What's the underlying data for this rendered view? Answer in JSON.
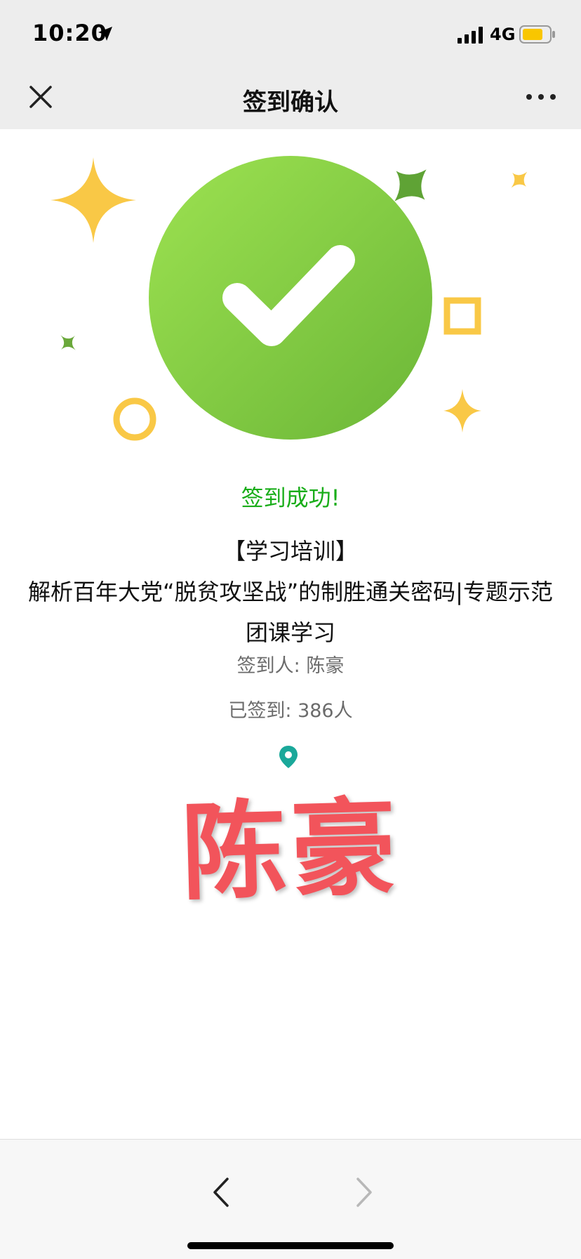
{
  "status_bar": {
    "time": "10:20",
    "network": "4G"
  },
  "nav": {
    "title": "签到确认"
  },
  "content": {
    "success_message": "签到成功!",
    "event_title": "【学习培训】\n解析百年大党“脱贫攻坚战”的制胜通关密码|专题示范团课学习",
    "signer": "签到人: 陈豪",
    "signed_count": "已签到: 386人",
    "stamp_name": "陈豪"
  },
  "colors": {
    "success_green": "#19ad19",
    "badge_green": "#7cc943",
    "accent_yellow": "#f9c846",
    "stamp_red": "#f2545b",
    "pin_teal": "#1aa89a"
  }
}
